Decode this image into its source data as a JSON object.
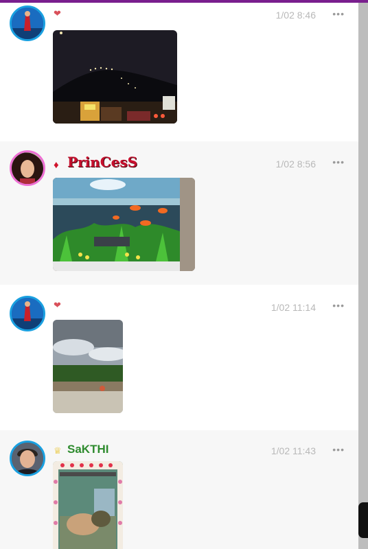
{
  "posts": [
    {
      "username": "",
      "badge_icon": "heart-icon",
      "timestamp": "1/02 8:46",
      "more_label": "•••",
      "photo": "night-hill-street-photo"
    },
    {
      "username": "PrinCesS",
      "badge_icon": "gem-icon",
      "timestamp": "1/02 8:56",
      "more_label": "•••",
      "photo": "aquarium-photo"
    },
    {
      "username": "",
      "badge_icon": "heart-icon",
      "timestamp": "1/02 11:14",
      "more_label": "•••",
      "photo": "cloudy-garden-photo"
    },
    {
      "username": "SaKTHI",
      "badge_icon": "crown-icon",
      "timestamp": "1/02 11:43",
      "more_label": "•••",
      "photo": "decorated-cat-photo"
    }
  ],
  "colors": {
    "accent_bar": "#7a1f8e",
    "username_princess": "#c8102e",
    "username_sakthi": "#2e8b2e",
    "avatar_ring": "#1aa0e0",
    "avatar_ring_pink": "#ee6fd3"
  }
}
